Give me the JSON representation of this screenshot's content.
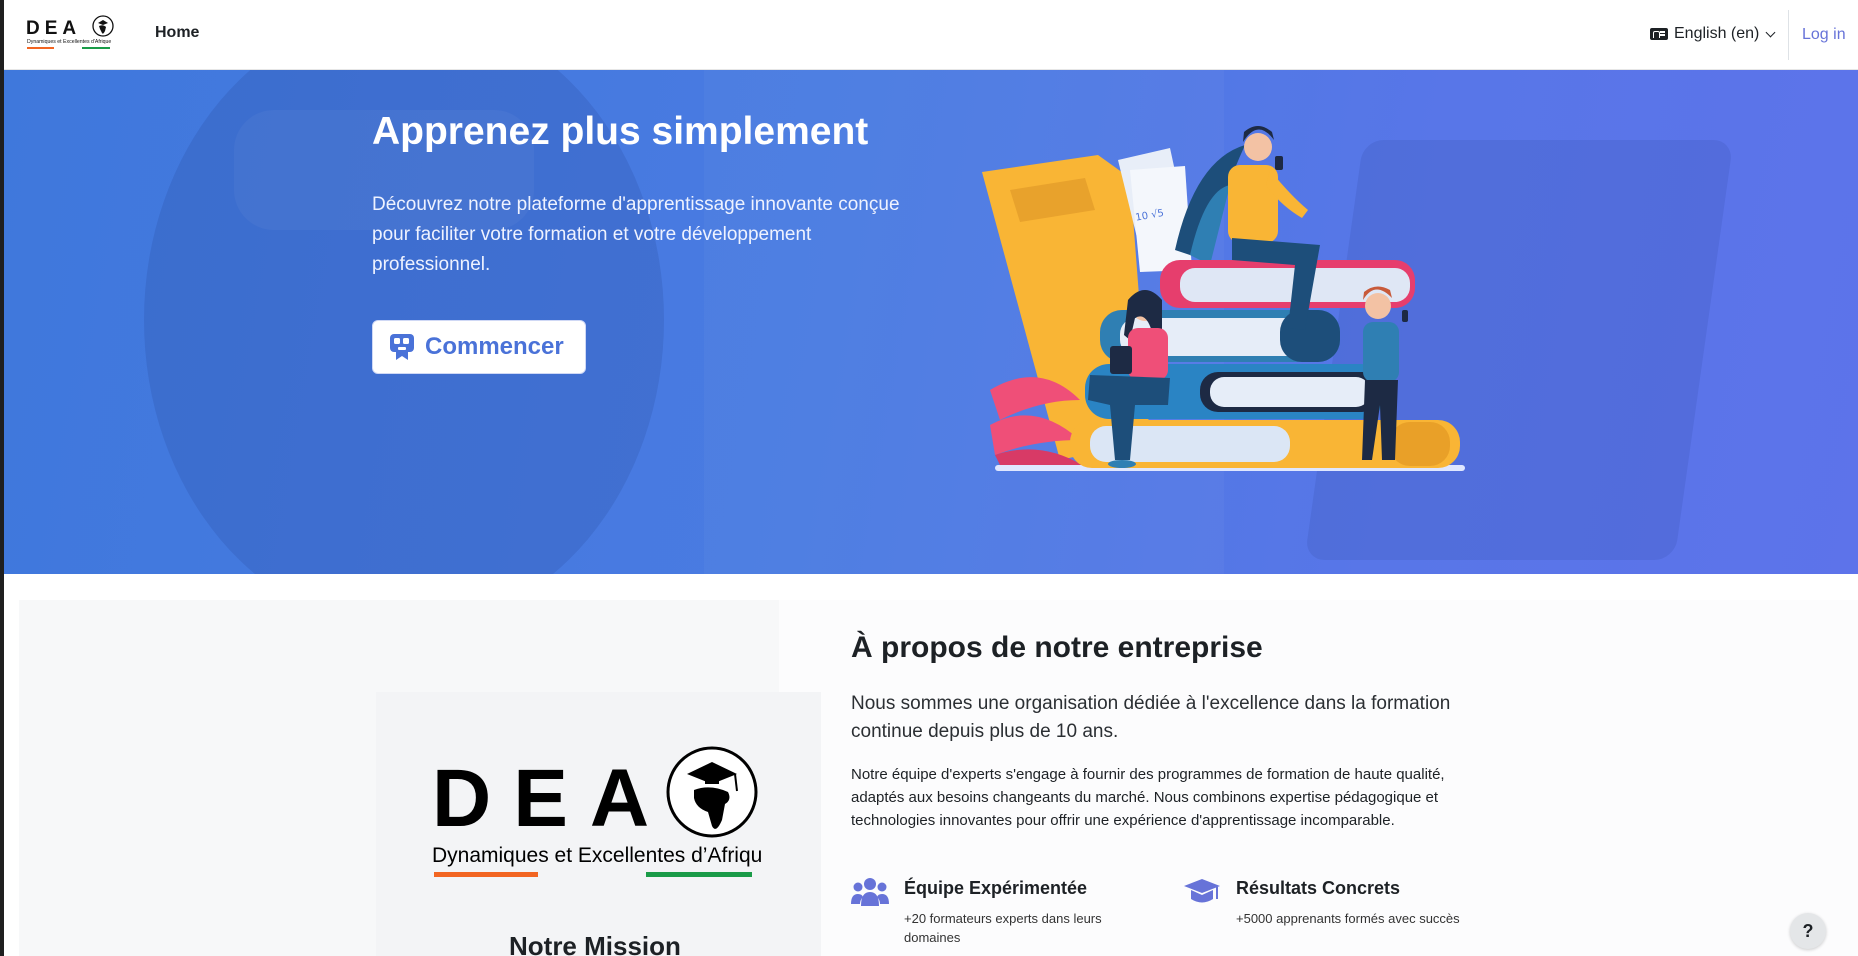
{
  "navbar": {
    "logo_letters": "DEA",
    "logo_tagline": "Dynamiques et Excellentes d'Afrique",
    "home_label": "Home",
    "language_label": "English (en)",
    "login_label": "Log in"
  },
  "hero": {
    "title": "Apprenez plus simplement",
    "text": "Découvrez notre plateforme d'apprentissage innovante conçue pour faciliter votre formation et votre développement professionnel.",
    "cta_label": "Commencer",
    "illustration_text": "10 √5"
  },
  "about": {
    "logo_letters": "DEA",
    "logo_tagline": "Dynamiques et Excellentes d’Afrique",
    "mission_title": "Notre Mission",
    "title": "À propos de notre entreprise",
    "lead": "Nous sommes une organisation dédiée à l'excellence dans la formation continue depuis plus de 10 ans.",
    "body": "Notre équipe d'experts s'engage à fournir des programmes de formation de haute qualité, adaptés aux besoins changeants du marché. Nous combinons expertise pédagogique et technologies innovantes pour offrir une expérience d'apprentissage incomparable.",
    "features": [
      {
        "icon": "users-icon",
        "title": "Équipe Expérimentée",
        "text": "+20 formateurs experts dans leurs domaines"
      },
      {
        "icon": "graduation-cap-icon",
        "title": "Résultats Concrets",
        "text": "+5000 apprenants formés avec succès"
      }
    ]
  },
  "help_label": "?",
  "colors": {
    "accent": "#6773d8",
    "hero_start": "#3f78dc",
    "hero_end": "#5d73ea",
    "cta_text": "#4a72d8",
    "logo_orange": "#f26522",
    "logo_green": "#1a9b48"
  }
}
